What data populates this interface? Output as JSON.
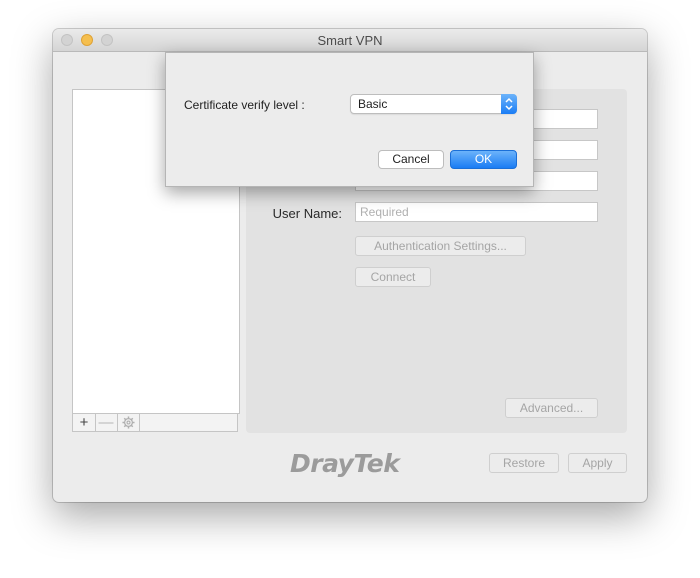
{
  "window": {
    "title": "Smart VPN",
    "controls": [
      "close",
      "minimize",
      "zoom"
    ]
  },
  "profile_list": {
    "toolbar": {
      "add_symbol": "+",
      "remove_symbol": "—",
      "settings_icon": "gear-icon"
    }
  },
  "details": {
    "user_name_label": "User Name:",
    "user_name_placeholder": "Required",
    "authentication_settings_label": "Authentication Settings...",
    "connect_label": "Connect",
    "advanced_label": "Advanced..."
  },
  "footer": {
    "logo_text": "DrayTek",
    "restore_label": "Restore",
    "apply_label": "Apply"
  },
  "dialog": {
    "certificate_label": "Certificate verify level :",
    "certificate_value": "Basic",
    "cancel_label": "Cancel",
    "ok_label": "OK"
  },
  "colors": {
    "accent": "#1b7df5",
    "window_bg": "#ececec",
    "panel_bg": "#e2e2e2"
  }
}
